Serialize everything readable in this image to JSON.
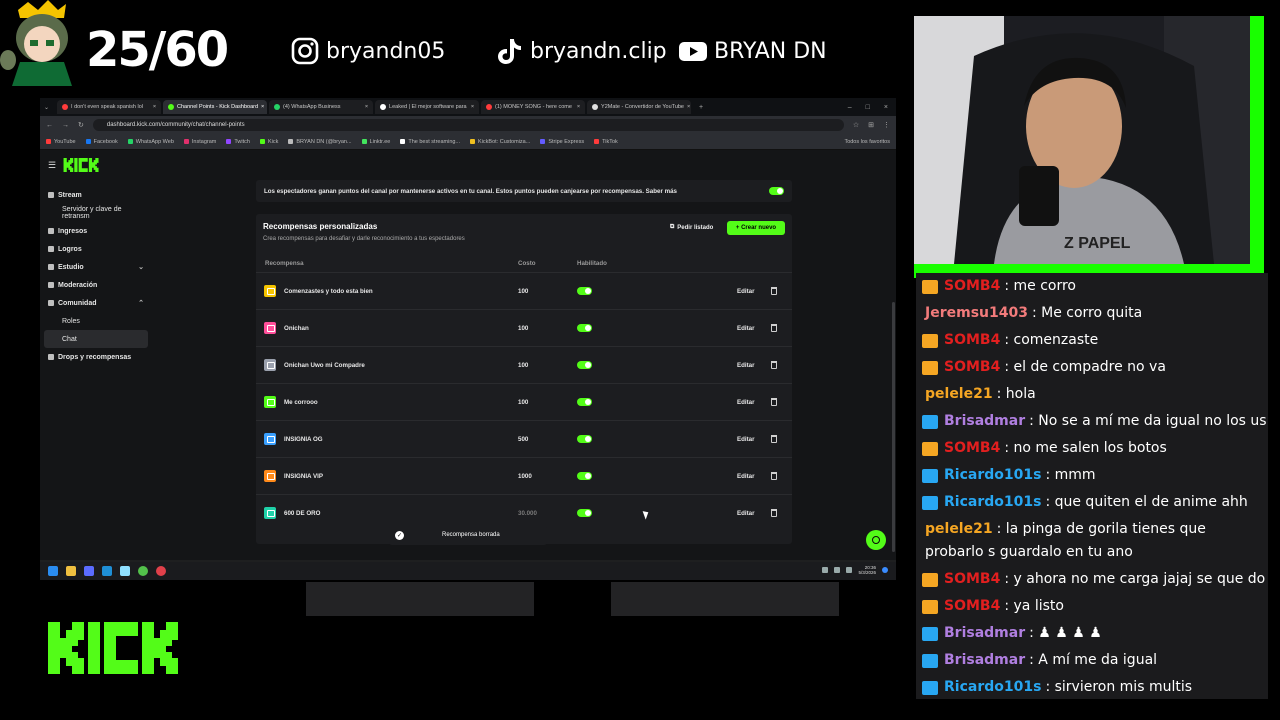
{
  "overlay": {
    "counter": "25/60",
    "instagram": "bryandn05",
    "tiktok": "bryandn.clip",
    "youtube": "BRYAN DN",
    "kick_logo": "KICK"
  },
  "browser": {
    "tabs": [
      {
        "title": "I don't even speak spanish lol",
        "color": "#ff3b3b",
        "active": false
      },
      {
        "title": "Channel Points - Kick Dashboard",
        "color": "#53fc18",
        "active": true
      },
      {
        "title": "(4) WhatsApp Business",
        "color": "#25d366",
        "active": false
      },
      {
        "title": "Leaked | El mejor software para",
        "color": "#ffffff",
        "active": false
      },
      {
        "title": "(1) MONEY SONG - here come",
        "color": "#ff3b3b",
        "active": false
      },
      {
        "title": "Y2Mate - Convertidor de YouTube",
        "color": "#e0e0e0",
        "active": false
      }
    ],
    "url": "dashboard.kick.com/community/chat/channel-points",
    "bookmarks": [
      {
        "label": "YouTube",
        "color": "#ff3b3b"
      },
      {
        "label": "Facebook",
        "color": "#1877f2"
      },
      {
        "label": "WhatsApp Web",
        "color": "#25d366"
      },
      {
        "label": "Instagram",
        "color": "#e1306c"
      },
      {
        "label": "Twitch",
        "color": "#9146ff"
      },
      {
        "label": "Kick",
        "color": "#53fc18"
      },
      {
        "label": "BRYAN DN (@bryan...",
        "color": "#bbbbbb"
      },
      {
        "label": "Linktr.ee",
        "color": "#43e55e"
      },
      {
        "label": "The best streaming...",
        "color": "#ffffff"
      },
      {
        "label": "KickBot: Customiza...",
        "color": "#f0c020"
      },
      {
        "label": "Stripe Express",
        "color": "#635bff"
      },
      {
        "label": "TikTok",
        "color": "#ff3b3b"
      }
    ],
    "bookmarks_all": "Todos los favoritos"
  },
  "sidebar": {
    "items": [
      {
        "label": "Stream",
        "sub": false,
        "active": false,
        "chevron": ""
      },
      {
        "label": "Servidor y clave de retransm",
        "sub": true,
        "active": false,
        "chevron": ""
      },
      {
        "label": "Ingresos",
        "sub": false,
        "active": false,
        "chevron": ""
      },
      {
        "label": "Logros",
        "sub": false,
        "active": false,
        "chevron": ""
      },
      {
        "label": "Estudio",
        "sub": false,
        "active": false,
        "chevron": "⌄"
      },
      {
        "label": "Moderación",
        "sub": false,
        "active": false,
        "chevron": ""
      },
      {
        "label": "Comunidad",
        "sub": false,
        "active": false,
        "chevron": "⌃"
      },
      {
        "label": "Roles",
        "sub": true,
        "active": false,
        "chevron": ""
      },
      {
        "label": "Chat",
        "sub": true,
        "active": true,
        "chevron": ""
      },
      {
        "label": "Drops y recompensas",
        "sub": false,
        "active": false,
        "chevron": ""
      }
    ]
  },
  "main": {
    "info_text": "Los espectadores ganan puntos del canal por mantenerse activos en tu canal. Estos puntos pueden canjearse por recompensas. Saber más",
    "panel_title": "Recompensas personalizadas",
    "panel_subtitle": "Crea recompensas para desafiar y darle reconocimiento a tus espectadores",
    "request_list_label": "Pedir listado",
    "create_new_label": "+ Crear nuevo",
    "columns": {
      "reward": "Recompensa",
      "cost": "Costo",
      "enabled": "Habilitado"
    },
    "edit_label": "Editar",
    "rewards": [
      {
        "name": "Comenzastes y todo esta bien",
        "cost": "100",
        "icon_color": "#f5c400",
        "enabled": true
      },
      {
        "name": "Onichan",
        "cost": "100",
        "icon_color": "#ff4f9a",
        "enabled": true
      },
      {
        "name": "Onichan Uwo mi Compadre",
        "cost": "100",
        "icon_color": "#9aa0ad",
        "enabled": true
      },
      {
        "name": "Me corrooo",
        "cost": "100",
        "icon_color": "#53fc18",
        "enabled": true
      },
      {
        "name": "INSIGNIA OG",
        "cost": "500",
        "icon_color": "#3aa0ff",
        "enabled": true
      },
      {
        "name": "INSIGNIA VIP",
        "cost": "1000",
        "icon_color": "#ff8a1a",
        "enabled": true
      },
      {
        "name": "600 DE ORO",
        "cost": "30.000",
        "icon_color": "#1fd1a8",
        "enabled": true
      }
    ],
    "toast": "Recompensa borrada"
  },
  "taskbar": {
    "time": "20:36",
    "date": "5/3/2026"
  },
  "chat": {
    "messages": [
      {
        "user": "SOMB4",
        "color": "#e21f1f",
        "badge": "crown",
        "text": "me corro"
      },
      {
        "user": "Jeremsu1403",
        "color": "#f27b7b",
        "badge": "",
        "text": "Me corro quita"
      },
      {
        "user": "SOMB4",
        "color": "#e21f1f",
        "badge": "crown",
        "text": "comenzaste"
      },
      {
        "user": "SOMB4",
        "color": "#e21f1f",
        "badge": "crown",
        "text": "el de compadre no va"
      },
      {
        "user": "pelele21",
        "color": "#f5a623",
        "badge": "",
        "text": "hola"
      },
      {
        "user": "Brisadmar",
        "color": "#b07fe0",
        "badge": "sub",
        "text": "No se a mí me da igual no los us"
      },
      {
        "user": "SOMB4",
        "color": "#e21f1f",
        "badge": "crown",
        "text": "no me salen los botos"
      },
      {
        "user": "Ricardo101s",
        "color": "#28a7f2",
        "badge": "sub",
        "text": "mmm"
      },
      {
        "user": "Ricardo101s",
        "color": "#28a7f2",
        "badge": "sub",
        "text": "que quiten el de anime ahh"
      },
      {
        "user": "pelele21",
        "color": "#f5a623",
        "badge": "",
        "text": "la pinga de gorila tienes que probarlo s guardalo en tu ano"
      },
      {
        "user": "SOMB4",
        "color": "#e21f1f",
        "badge": "crown",
        "text": "y ahora no me carga jajaj se que do ne"
      },
      {
        "user": "SOMB4",
        "color": "#e21f1f",
        "badge": "crown",
        "text": "ya listo"
      },
      {
        "user": "Brisadmar",
        "color": "#b07fe0",
        "badge": "sub",
        "text": "♟ ♟ ♟ ♟"
      },
      {
        "user": "Brisadmar",
        "color": "#b07fe0",
        "badge": "sub",
        "text": "A mí me da igual"
      },
      {
        "user": "Ricardo101s",
        "color": "#28a7f2",
        "badge": "sub",
        "text": "sirvieron mis multis"
      }
    ]
  },
  "colors": {
    "kick_green": "#53fc18",
    "frame_green": "#19ff00",
    "panel": "#1c1d20"
  }
}
